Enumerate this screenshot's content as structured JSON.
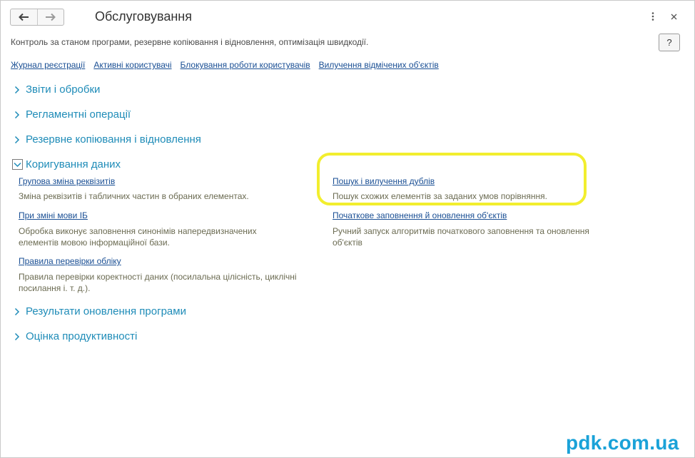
{
  "window": {
    "title": "Обслуговування",
    "subtitle": "Контроль за станом програми, резервне копіювання і відновлення, оптимізація швидкодії.",
    "help_label": "?"
  },
  "toplinks": [
    {
      "label": "Журнал реєстрації"
    },
    {
      "label": "Активні користувачі"
    },
    {
      "label": "Блокування роботи користувачів"
    },
    {
      "label": "Вилучення відмічених об'єктів"
    }
  ],
  "groups": {
    "reports": "Звіти і обробки",
    "routine": "Регламентні операції",
    "backup": "Резервне копіювання і відновлення",
    "data_correction": "Коригування даних",
    "update_results": "Результати оновлення програми",
    "performance": "Оцінка продуктивності"
  },
  "commands": {
    "group_change": {
      "label": "Групова зміна реквізитів",
      "desc": "Зміна реквізитів і табличних частин в обраних елементах."
    },
    "language_change": {
      "label": "При зміні мови ІБ",
      "desc": "Обробка виконує заповнення синонімів напередвизначених елементів  мовою інформаційної бази."
    },
    "checks": {
      "label": "Правила перевірки обліку",
      "desc": "Правила перевірки коректності даних (посилальна цілісність, циклічні посилання і. т. д.)."
    },
    "duplicates": {
      "label": "Пошук і вилучення дублів",
      "desc": "Пошук схожих елементів за заданих умов порівняння."
    },
    "initial_fill": {
      "label": "Початкове заповнення й оновлення об'єктів",
      "desc": "Ручний запуск алгоритмів початкового заповнення та оновлення об'єктів"
    }
  },
  "watermark": "pdk.com.ua",
  "colors": {
    "link": "#1a4f94",
    "group": "#1f8cb8",
    "highlight": "#f2ee2e",
    "watermark": "#1aa2d8"
  }
}
